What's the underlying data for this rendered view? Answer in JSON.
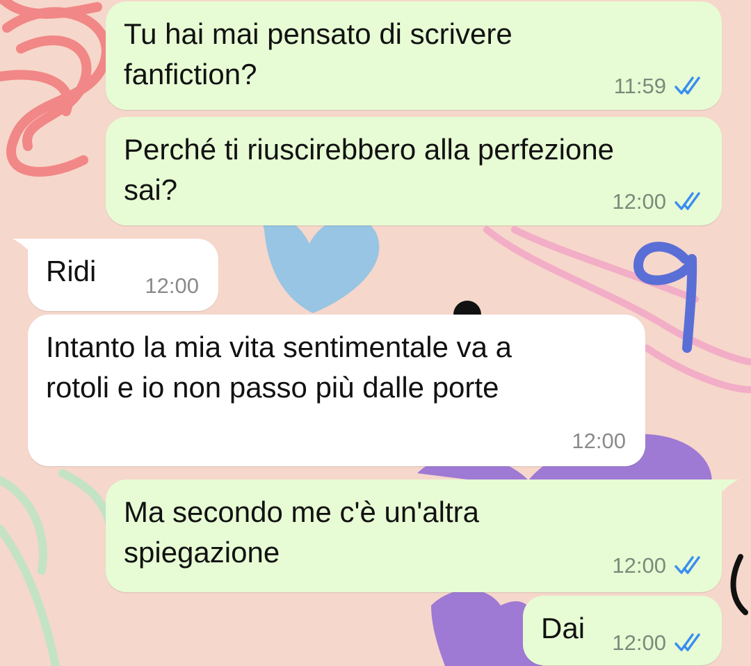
{
  "colors": {
    "outgoing_bubble": "#e7fcd4",
    "incoming_bubble": "#ffffff",
    "read_ticks": "#3a8ef0",
    "wallpaper": "#f6d7cb",
    "annotation_ink": "#5a6fd6"
  },
  "annotations": {
    "handwritten_mark": "9"
  },
  "messages": [
    {
      "direction": "outgoing",
      "text": "Tu hai mai pensato di scrivere\nfanfiction?",
      "time": "11:59",
      "status": "read"
    },
    {
      "direction": "outgoing",
      "text": "Perché ti riuscirebbero alla perfezione\nsai?",
      "time": "12:00",
      "status": "read"
    },
    {
      "direction": "incoming",
      "text": "Ridi",
      "time": "12:00"
    },
    {
      "direction": "incoming",
      "text": "Intanto la mia vita sentimentale va a\nrotoli e io non passo più dalle porte",
      "time": "12:00"
    },
    {
      "direction": "outgoing",
      "text": "Ma secondo me c'è un'altra\nspiegazione",
      "time": "12:00",
      "status": "read"
    },
    {
      "direction": "outgoing",
      "text": "Dai",
      "time": "12:00",
      "status": "read"
    }
  ]
}
